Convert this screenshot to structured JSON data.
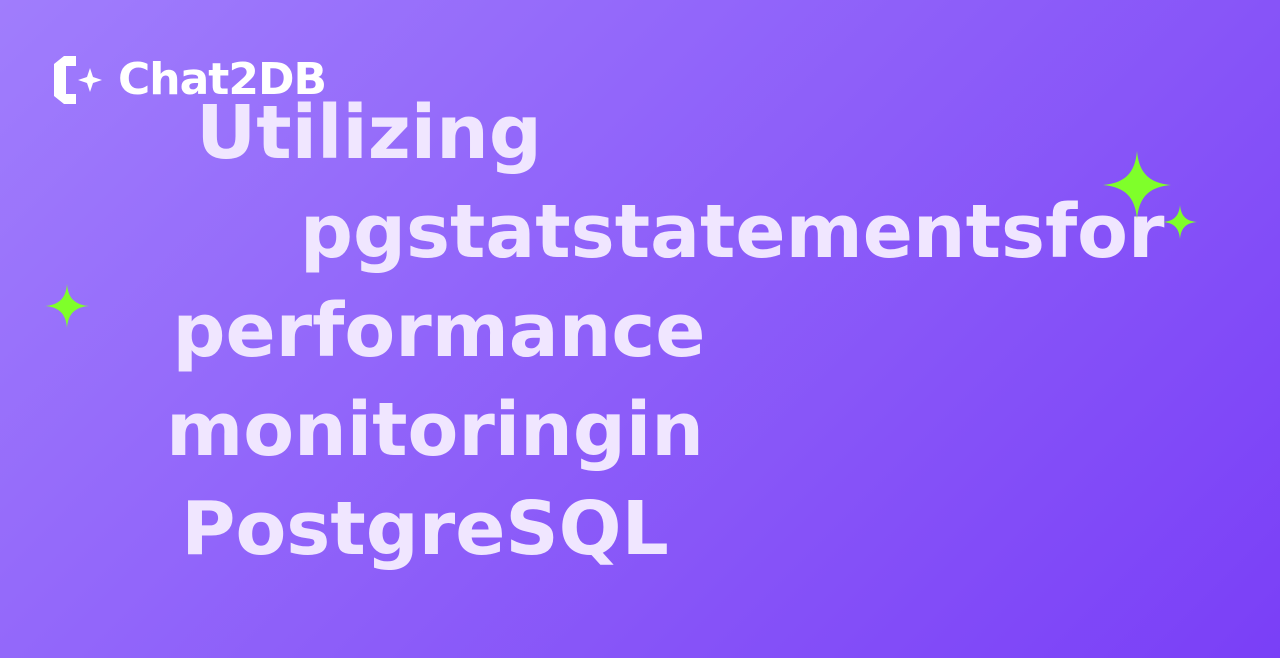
{
  "logo": {
    "text": "Chat2DB"
  },
  "title": {
    "lines": [
      "Utilizing",
      "pgstatstatementsfor",
      "performance",
      "monitoringin",
      "PostgreSQL"
    ]
  },
  "colors": {
    "background_start": "#a07dfc",
    "background_end": "#7a3ff7",
    "title": "#f0e6ff",
    "sparkle": "#7fff2a",
    "logo": "#ffffff"
  },
  "icons": [
    "chat2db-logo-icon",
    "sparkle-icon"
  ]
}
